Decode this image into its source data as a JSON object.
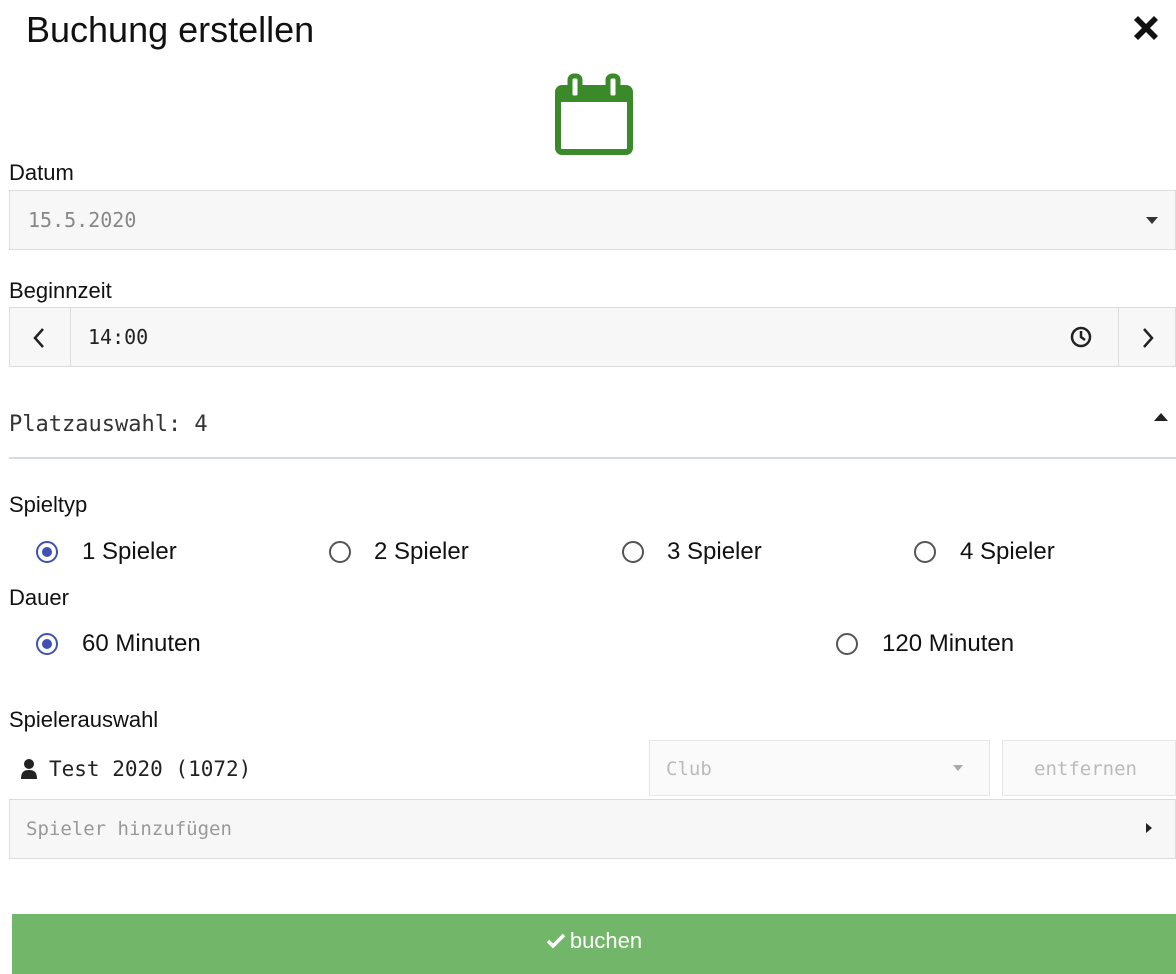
{
  "dialog": {
    "title": "Buchung erstellen",
    "close_icon": "close-icon"
  },
  "header_icon": {
    "name": "calendar-icon",
    "color": "#3a8a2a"
  },
  "date": {
    "label": "Datum",
    "value": "15.5.2020"
  },
  "start_time": {
    "label": "Beginnzeit",
    "value": "14:00"
  },
  "court": {
    "label": "Platzauswahl: 4"
  },
  "game_type": {
    "label": "Spieltyp",
    "options": [
      "1 Spieler",
      "2 Spieler",
      "3 Spieler",
      "4 Spieler"
    ],
    "selected": "1 Spieler"
  },
  "duration": {
    "label": "Dauer",
    "options": [
      "60 Minuten",
      "120 Minuten"
    ],
    "selected": "60 Minuten"
  },
  "players": {
    "label": "Spielerauswahl",
    "player_name": "Test 2020 (1072)",
    "club_placeholder": "Club",
    "remove_label": "entfernen",
    "add_placeholder": "Spieler hinzufügen"
  },
  "submit": {
    "label": "buchen",
    "color": "#72b769"
  },
  "colors": {
    "radio_selected": "#3f51b5"
  }
}
